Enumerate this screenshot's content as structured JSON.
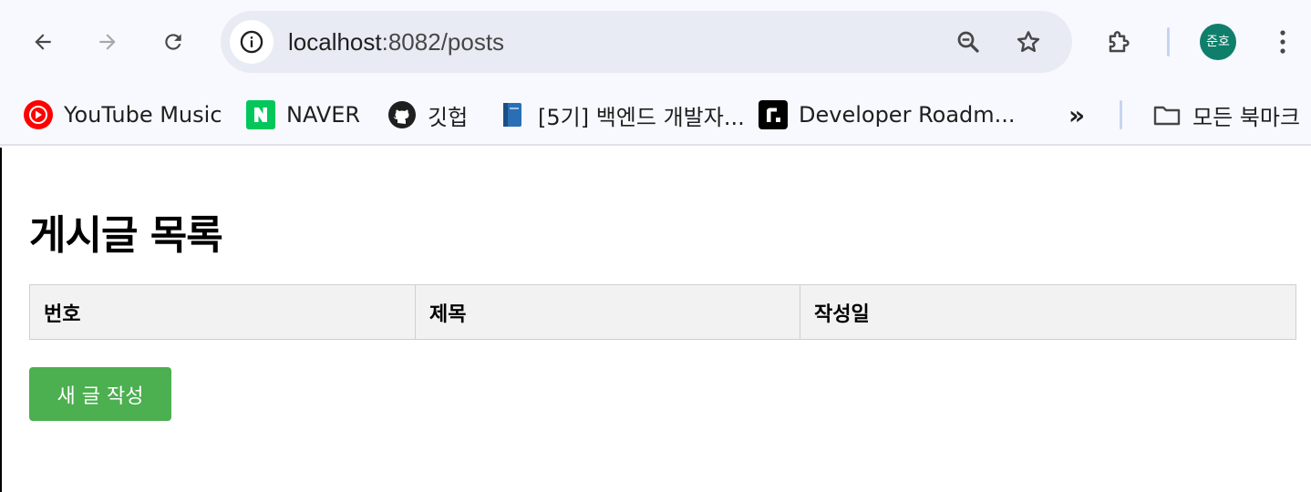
{
  "browser": {
    "url_host": "localhost",
    "url_rest": ":8082/posts",
    "profile_initials": "준호"
  },
  "bookmarks": [
    {
      "label": "YouTube Music",
      "icon": "youtube-music-icon"
    },
    {
      "label": "NAVER",
      "icon": "naver-icon"
    },
    {
      "label": "깃헙",
      "icon": "github-icon"
    },
    {
      "label": "[5기] 백엔드 개발자...",
      "icon": "book-icon"
    },
    {
      "label": "Developer Roadm...",
      "icon": "roadmap-icon"
    }
  ],
  "bookmarks_overflow": "»",
  "all_bookmarks_label": "모든 북마크",
  "page": {
    "title": "게시글 목록",
    "table_headers": [
      "번호",
      "제목",
      "작성일"
    ],
    "new_post_button": "새 글 작성"
  },
  "colors": {
    "button_green": "#4caf50",
    "avatar": "#0f7f6c",
    "header_bg": "#f2f2f2"
  }
}
